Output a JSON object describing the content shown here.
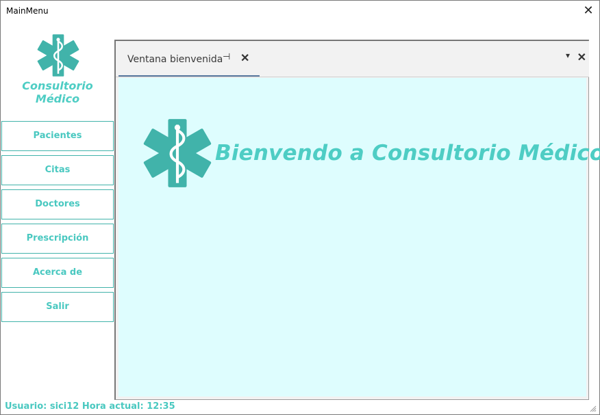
{
  "window": {
    "title": "MainMenu",
    "close": "✕"
  },
  "brand": {
    "name": "Consultorio Médico",
    "color": "#4ecdc4",
    "icon": "star-of-life-icon"
  },
  "nav": {
    "items": [
      {
        "label": "Pacientes"
      },
      {
        "label": "Citas"
      },
      {
        "label": "Doctores"
      },
      {
        "label": "Prescripción"
      },
      {
        "label": "Acerca de"
      },
      {
        "label": "Salir"
      }
    ]
  },
  "dock": {
    "tab": {
      "label": "Ventana bienvenida",
      "pin": "⊣",
      "close": "✕"
    },
    "menu": "▾",
    "close": "✕"
  },
  "welcome": {
    "message": "Bienvendo a Consultorio Médico",
    "background": "#defdfe"
  },
  "status": {
    "text": "Usuario: sici12 Hora actual: 12:35"
  }
}
